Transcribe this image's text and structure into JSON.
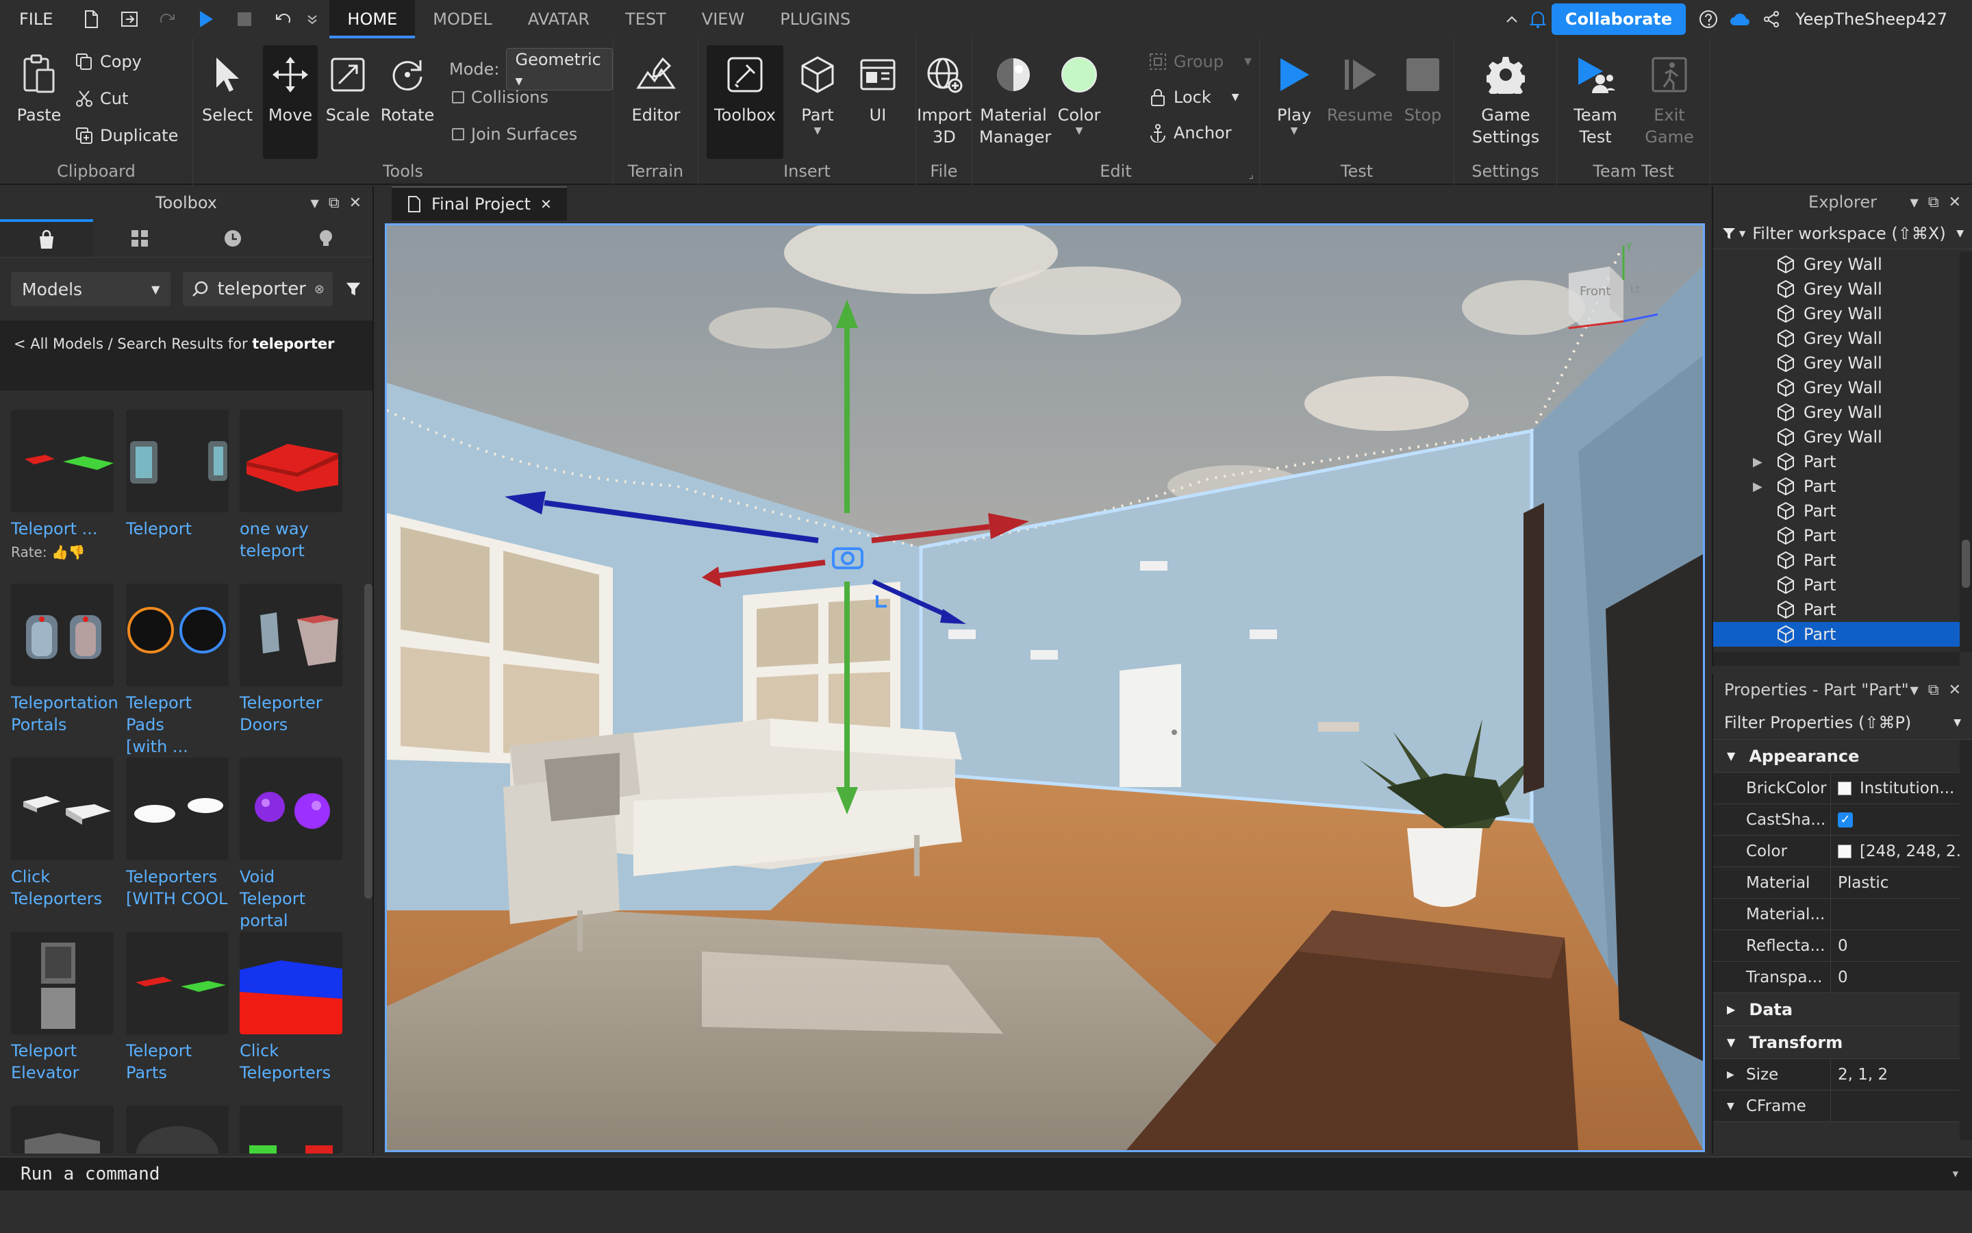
{
  "menubar": {
    "file": "FILE",
    "tabs": [
      "HOME",
      "MODEL",
      "AVATAR",
      "TEST",
      "VIEW",
      "PLUGINS"
    ],
    "active_tab": "HOME",
    "collaborate": "Collaborate",
    "username": "YeepTheSheep427"
  },
  "ribbon": {
    "clipboard": {
      "paste": "Paste",
      "copy": "Copy",
      "cut": "Cut",
      "duplicate": "Duplicate",
      "label": "Clipboard"
    },
    "tools": {
      "select": "Select",
      "move": "Move",
      "scale": "Scale",
      "rotate": "Rotate",
      "mode_label": "Mode:",
      "mode_value": "Geometric",
      "collisions": "Collisions",
      "join_surfaces": "Join Surfaces",
      "label": "Tools"
    },
    "terrain": {
      "editor": "Editor",
      "label": "Terrain"
    },
    "insert": {
      "toolbox": "Toolbox",
      "part": "Part",
      "ui": "UI",
      "label": "Insert"
    },
    "file": {
      "import3d_line1": "Import",
      "import3d_line2": "3D",
      "label": "File"
    },
    "edit": {
      "material_line1": "Material",
      "material_line2": "Manager",
      "color": "Color",
      "group": "Group",
      "lock": "Lock",
      "anchor": "Anchor",
      "label": "Edit"
    },
    "test": {
      "play": "Play",
      "resume": "Resume",
      "stop": "Stop",
      "label": "Test"
    },
    "settings": {
      "game_line1": "Game",
      "game_line2": "Settings",
      "label": "Settings"
    },
    "teamtest": {
      "team_line1": "Team",
      "team_line2": "Test",
      "exit_line1": "Exit",
      "exit_line2": "Game",
      "label": "Team Test"
    }
  },
  "toolbox": {
    "title": "Toolbox",
    "category": "Models",
    "search_value": "teleporter",
    "breadcrumb_prefix": "< All Models / Search Results for ",
    "breadcrumb_term": "teleporter",
    "rate_label": "Rate:",
    "items": [
      {
        "l1": "Teleport ...",
        "l2": ""
      },
      {
        "l1": "Teleport",
        "l2": ""
      },
      {
        "l1": "one way",
        "l2": "teleport"
      },
      {
        "l1": "Teleportation",
        "l2": "Portals"
      },
      {
        "l1": "Teleport Pads",
        "l2": "[with ..."
      },
      {
        "l1": "Teleporter",
        "l2": "Doors"
      },
      {
        "l1": "Click",
        "l2": "Teleporters"
      },
      {
        "l1": "Teleporters",
        "l2": "[WITH COOL"
      },
      {
        "l1": "Void Teleport",
        "l2": "portal"
      },
      {
        "l1": "Teleport",
        "l2": "Elevator"
      },
      {
        "l1": "Teleport",
        "l2": "Parts"
      },
      {
        "l1": "Click",
        "l2": "Teleporters"
      }
    ]
  },
  "document": {
    "tab_title": "Final Project"
  },
  "viewcube": {
    "front": "Front",
    "side": "Lt",
    "axis_y": "Y"
  },
  "explorer": {
    "title": "Explorer",
    "filter": "Filter workspace (⇧⌘X)",
    "rows": [
      {
        "label": "Grey Wall",
        "expandable": false
      },
      {
        "label": "Grey Wall",
        "expandable": false
      },
      {
        "label": "Grey Wall",
        "expandable": false
      },
      {
        "label": "Grey Wall",
        "expandable": false
      },
      {
        "label": "Grey Wall",
        "expandable": false
      },
      {
        "label": "Grey Wall",
        "expandable": false
      },
      {
        "label": "Grey Wall",
        "expandable": false
      },
      {
        "label": "Grey Wall",
        "expandable": false
      },
      {
        "label": "Part",
        "expandable": true
      },
      {
        "label": "Part",
        "expandable": true
      },
      {
        "label": "Part",
        "expandable": false
      },
      {
        "label": "Part",
        "expandable": false
      },
      {
        "label": "Part",
        "expandable": false
      },
      {
        "label": "Part",
        "expandable": false
      },
      {
        "label": "Part",
        "expandable": false
      },
      {
        "label": "Part",
        "expandable": false
      }
    ]
  },
  "properties": {
    "title": "Properties - Part \"Part\"",
    "filter": "Filter Properties (⇧⌘P)",
    "appearance": "Appearance",
    "rows": [
      {
        "name": "BrickColor",
        "value": "Institution...",
        "swatch": true
      },
      {
        "name": "CastSha...",
        "value": "",
        "checkbox": true
      },
      {
        "name": "Color",
        "value": "[248, 248, 2...",
        "swatch": true
      },
      {
        "name": "Material",
        "value": "Plastic"
      },
      {
        "name": "Material...",
        "value": ""
      },
      {
        "name": "Reflecta...",
        "value": "0"
      },
      {
        "name": "Transpa...",
        "value": "0"
      }
    ],
    "data": "Data",
    "transform": "Transform",
    "size_name": "Size",
    "size_value": "2, 1, 2",
    "cframe": "CFrame"
  },
  "command": {
    "placeholder": "Run a command"
  },
  "colors": {
    "accent": "#1d8af5",
    "selection": "#0f5fc8",
    "background": "#2e2e2e",
    "link": "#5ab0ff"
  }
}
